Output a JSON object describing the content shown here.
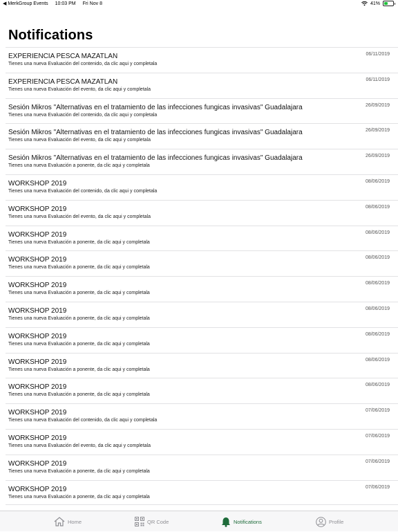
{
  "status_bar": {
    "back_app": "MerkGroup Events",
    "time": "10:03 PM",
    "date": "Fri Nov 8",
    "battery_percent": "41%"
  },
  "page_title": "Notifications",
  "notifications": [
    {
      "title": "EXPERIENCIA PESCA MAZATLAN",
      "subtitle": "Tienes una nueva Evaluación del contenido, da clic aqui y completala",
      "date": "06/11/2019"
    },
    {
      "title": "EXPERIENCIA PESCA MAZATLAN",
      "subtitle": "Tienes una nueva Evaluación del evento, da clic aqui y completala",
      "date": "06/11/2019"
    },
    {
      "title": "Sesión Mikros \"Alternativas en el tratamiento de las infecciones fungicas invasivas\" Guadalajara",
      "subtitle": "Tienes una nueva Evaluación del contenido, da clic aqui y completala",
      "date": "26/09/2019"
    },
    {
      "title": "Sesión Mikros \"Alternativas en el tratamiento de las infecciones fungicas invasivas\" Guadalajara",
      "subtitle": "Tienes una nueva Evaluación del evento, da clic aqui y completala",
      "date": "26/09/2019"
    },
    {
      "title": "Sesión Mikros \"Alternativas en el tratamiento de las infecciones fungicas invasivas\" Guadalajara",
      "subtitle": "Tienes una nueva Evaluación a ponente, da clic aqui y completala",
      "date": "26/09/2019"
    },
    {
      "title": "WORKSHOP 2019",
      "subtitle": "Tienes una nueva Evaluación del contenido, da clic aqui y completala",
      "date": "08/06/2019"
    },
    {
      "title": "WORKSHOP 2019",
      "subtitle": "Tienes una nueva Evaluación del evento, da clic aqui y completala",
      "date": "08/06/2019"
    },
    {
      "title": "WORKSHOP 2019",
      "subtitle": "Tienes una nueva Evaluación a ponente, da clic aqui y completala",
      "date": "08/06/2019"
    },
    {
      "title": "WORKSHOP 2019",
      "subtitle": "Tienes una nueva Evaluación a ponente, da clic aqui y completala",
      "date": "08/06/2019"
    },
    {
      "title": "WORKSHOP 2019",
      "subtitle": "Tienes una nueva Evaluación a ponente, da clic aqui y completala",
      "date": "08/06/2019"
    },
    {
      "title": "WORKSHOP 2019",
      "subtitle": "Tienes una nueva Evaluación a ponente, da clic aqui y completala",
      "date": "08/06/2019"
    },
    {
      "title": "WORKSHOP 2019",
      "subtitle": "Tienes una nueva Evaluación a ponente, da clic aqui y completala",
      "date": "08/06/2019"
    },
    {
      "title": "WORKSHOP 2019",
      "subtitle": "Tienes una nueva Evaluación a ponente, da clic aqui y completala",
      "date": "08/06/2019"
    },
    {
      "title": "WORKSHOP 2019",
      "subtitle": "Tienes una nueva Evaluación a ponente, da clic aqui y completala",
      "date": "08/06/2019"
    },
    {
      "title": "WORKSHOP 2019",
      "subtitle": "Tienes una nueva Evaluación del contenido, da clic aqui y completala",
      "date": "07/06/2019"
    },
    {
      "title": "WORKSHOP 2019",
      "subtitle": "Tienes una nueva Evaluación del evento, da clic aqui y completala",
      "date": "07/06/2019"
    },
    {
      "title": "WORKSHOP 2019",
      "subtitle": "Tienes una nueva Evaluación a ponente, da clic aqui y completala",
      "date": "07/06/2019"
    },
    {
      "title": "WORKSHOP 2019",
      "subtitle": "Tienes una nueva Evaluación a ponente, da clic aqui y completala",
      "date": "07/06/2019"
    }
  ],
  "tab_bar": {
    "tabs": [
      {
        "label": "Home",
        "icon": "home-icon",
        "active": false
      },
      {
        "label": "QR Code",
        "icon": "qr-code-icon",
        "active": false
      },
      {
        "label": "Notifications",
        "icon": "bell-icon",
        "active": true
      },
      {
        "label": "Profile",
        "icon": "profile-icon",
        "active": false
      }
    ]
  },
  "colors": {
    "active_tab": "#1e6b3a",
    "inactive_tab": "#8e8e93",
    "battery": "#1fbf3a",
    "separator": "#e2e2e4"
  }
}
